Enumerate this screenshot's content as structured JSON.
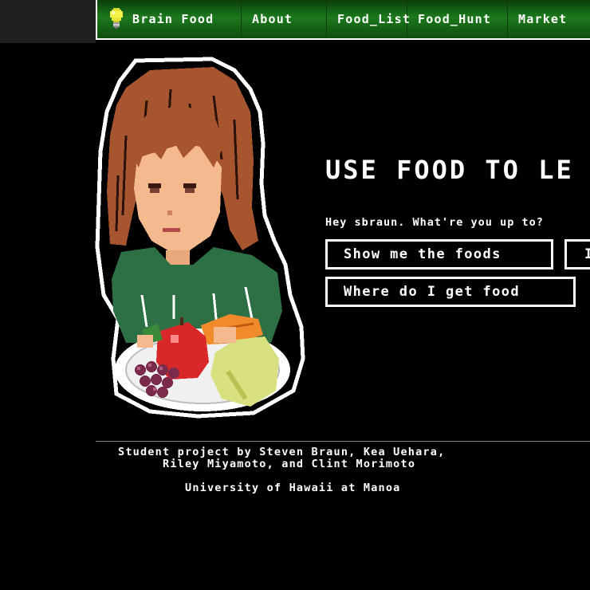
{
  "nav": {
    "brand": "Brain Food",
    "items": [
      {
        "label": "About"
      },
      {
        "label": "Food_List"
      },
      {
        "label": "Food_Hunt"
      },
      {
        "label": "Market"
      }
    ],
    "bar_color": "#1c7a1c"
  },
  "hero": {
    "headline": "USE FOOD TO LE",
    "greeting": "Hey sbraun. What're you up to?",
    "buttons": {
      "show_foods": "Show me the foods",
      "partial": "I",
      "where_food": "Where do I get food"
    }
  },
  "footer": {
    "credits_line1": "Student project by Steven Braun, Kea Uehara,",
    "credits_line2": "Riley Miyamoto, and Clint Morimoto",
    "university": "University of Hawaii at Manoa"
  },
  "icons": {
    "brand": "lightbulb-icon",
    "hero_image": "pixel-girl-with-fruit-illustration"
  }
}
